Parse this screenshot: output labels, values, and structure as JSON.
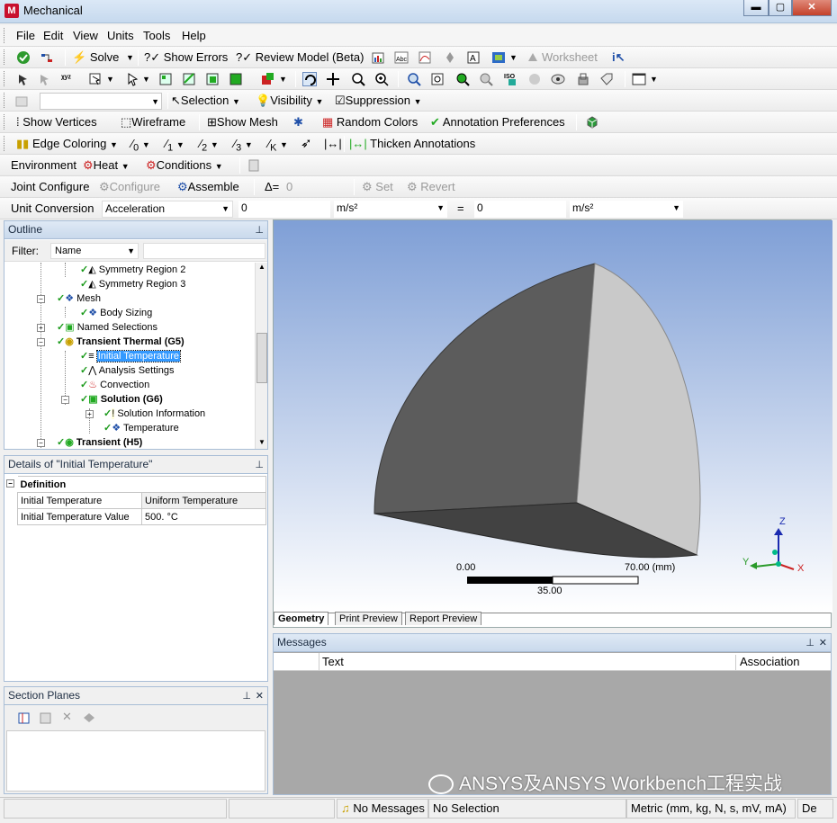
{
  "window": {
    "title": "Mechanical",
    "app_icon_letter": "M",
    "controls": [
      "▬",
      "▢",
      "✕"
    ]
  },
  "menu": [
    "File",
    "Edit",
    "View",
    "Units",
    "Tools",
    "Help"
  ],
  "toolbar1": {
    "solve": "Solve",
    "show_errors": "Show Errors",
    "review_model": "Review Model (Beta)",
    "worksheet": "Worksheet",
    "show_errors_prefix": "?",
    "review_prefix": "?"
  },
  "toolbar3": {
    "selection": "Selection",
    "visibility": "Visibility",
    "suppression": "Suppression"
  },
  "toolbar4": {
    "show_vertices": "Show Vertices",
    "wireframe": "Wireframe",
    "show_mesh": "Show Mesh",
    "random_colors": "Random Colors",
    "annotation_prefs": "Annotation Preferences"
  },
  "toolbar5": {
    "edge_coloring": "Edge Coloring",
    "thicken_annotations": "Thicken Annotations"
  },
  "toolbar6": {
    "environment": "Environment",
    "heat": "Heat",
    "conditions": "Conditions"
  },
  "toolbar7": {
    "joint_configure": "Joint Configure",
    "configure": "Configure",
    "assemble": "Assemble",
    "delta_label": "Δ=",
    "delta_value": "0",
    "set": "Set",
    "revert": "Revert"
  },
  "toolbar8": {
    "unit_conversion": "Unit Conversion",
    "quantity": "Acceleration",
    "value_in": "0",
    "unit_in": "m/s²",
    "equals": "=",
    "value_out": "0",
    "unit_out": "m/s²"
  },
  "outline": {
    "title": "Outline",
    "filter_label": "Filter:",
    "filter_value": "Name",
    "items": [
      {
        "label": "Symmetry Region 2",
        "bold": false
      },
      {
        "label": "Symmetry Region 3",
        "bold": false
      },
      {
        "label": "Mesh",
        "bold": false
      },
      {
        "label": "Body Sizing",
        "bold": false
      },
      {
        "label": "Named Selections",
        "bold": false
      },
      {
        "label": "Transient Thermal (G5)",
        "bold": true
      },
      {
        "label": "Initial Temperature",
        "bold": false,
        "selected": true
      },
      {
        "label": "Analysis Settings",
        "bold": false
      },
      {
        "label": "Convection",
        "bold": false
      },
      {
        "label": "Solution (G6)",
        "bold": true
      },
      {
        "label": "Solution Information",
        "bold": false
      },
      {
        "label": "Temperature",
        "bold": false
      },
      {
        "label": "Transient (H5)",
        "bold": true
      }
    ]
  },
  "details": {
    "title": "Details of \"Initial Temperature\"",
    "group": "Definition",
    "rows": [
      {
        "name": "Initial Temperature",
        "value": "Uniform Temperature"
      },
      {
        "name": "Initial Temperature Value",
        "value": "500. °C"
      }
    ]
  },
  "section_planes": {
    "title": "Section Planes"
  },
  "viewport": {
    "scale_start": "0.00",
    "scale_end": "70.00 (mm)",
    "scale_mid": "35.00",
    "axis_x": "X",
    "axis_y": "Y",
    "axis_z": "Z",
    "tabs": [
      "Geometry",
      "Print Preview",
      "Report Preview"
    ]
  },
  "messages": {
    "title": "Messages",
    "columns": [
      "Text",
      "Association"
    ]
  },
  "status": {
    "messages": "No Messages",
    "selection": "No Selection",
    "units": "Metric (mm, kg, N, s, mV, mA)",
    "extra": "De"
  },
  "watermark": "ANSYS及ANSYS Workbench工程实战"
}
